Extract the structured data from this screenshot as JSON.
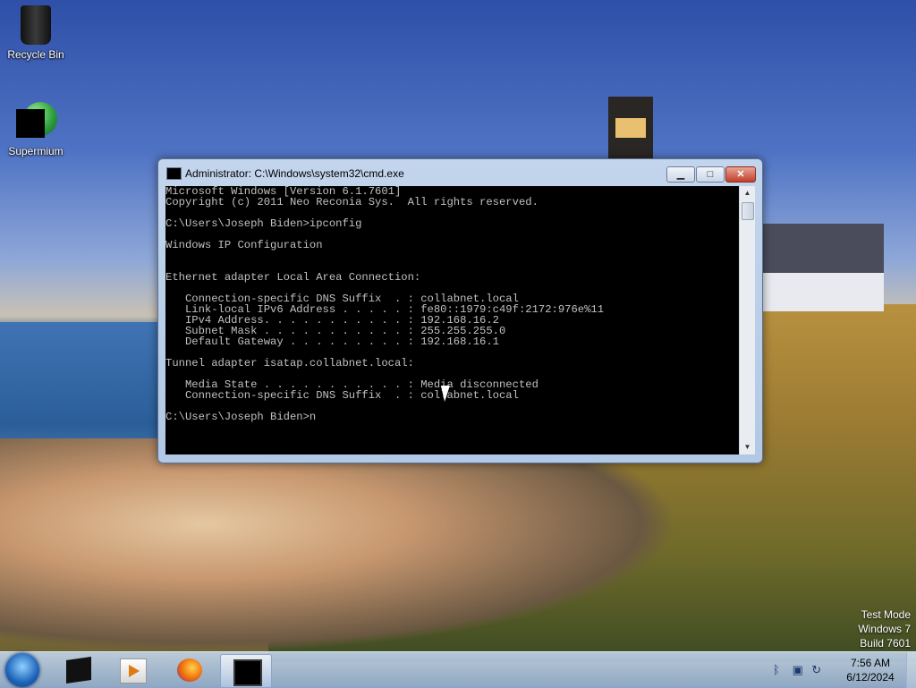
{
  "desktop": {
    "icons": [
      {
        "label": "Recycle Bin",
        "icon": "recycle-bin-icon"
      },
      {
        "label": "Supermium",
        "icon": "supermium-icon"
      }
    ],
    "watermark": {
      "line1": "Test Mode",
      "line2": "Windows 7",
      "line3": "Build 7601"
    }
  },
  "window": {
    "title": "Administrator: C:\\Windows\\system32\\cmd.exe",
    "buttons": {
      "minimize": "▁",
      "maximize": "□",
      "close": "✕"
    },
    "console_text": "Microsoft Windows [Version 6.1.7601]\nCopyright (c) 2011 Neo Reconia Sys.  All rights reserved.\n\nC:\\Users\\Joseph Biden>ipconfig\n\nWindows IP Configuration\n\n\nEthernet adapter Local Area Connection:\n\n   Connection-specific DNS Suffix  . : collabnet.local\n   Link-local IPv6 Address . . . . . : fe80::1979:c49f:2172:976e%11\n   IPv4 Address. . . . . . . . . . . : 192.168.16.2\n   Subnet Mask . . . . . . . . . . . : 255.255.255.0\n   Default Gateway . . . . . . . . . : 192.168.16.1\n\nTunnel adapter isatap.collabnet.local:\n\n   Media State . . . . . . . . . . . : Media disconnected\n   Connection-specific DNS Suffix  . : collabnet.local\n\nC:\\Users\\Joseph Biden>n"
  },
  "taskbar": {
    "items": [
      {
        "icon": "black-box-app-icon"
      },
      {
        "icon": "media-player-icon"
      },
      {
        "icon": "firefox-icon"
      },
      {
        "icon": "command-prompt-icon"
      }
    ],
    "tray_icons": [
      "bluetooth-icon",
      "network-icon",
      "sync-icon"
    ],
    "clock": {
      "time": "7:56 AM",
      "date": "6/12/2024"
    }
  }
}
